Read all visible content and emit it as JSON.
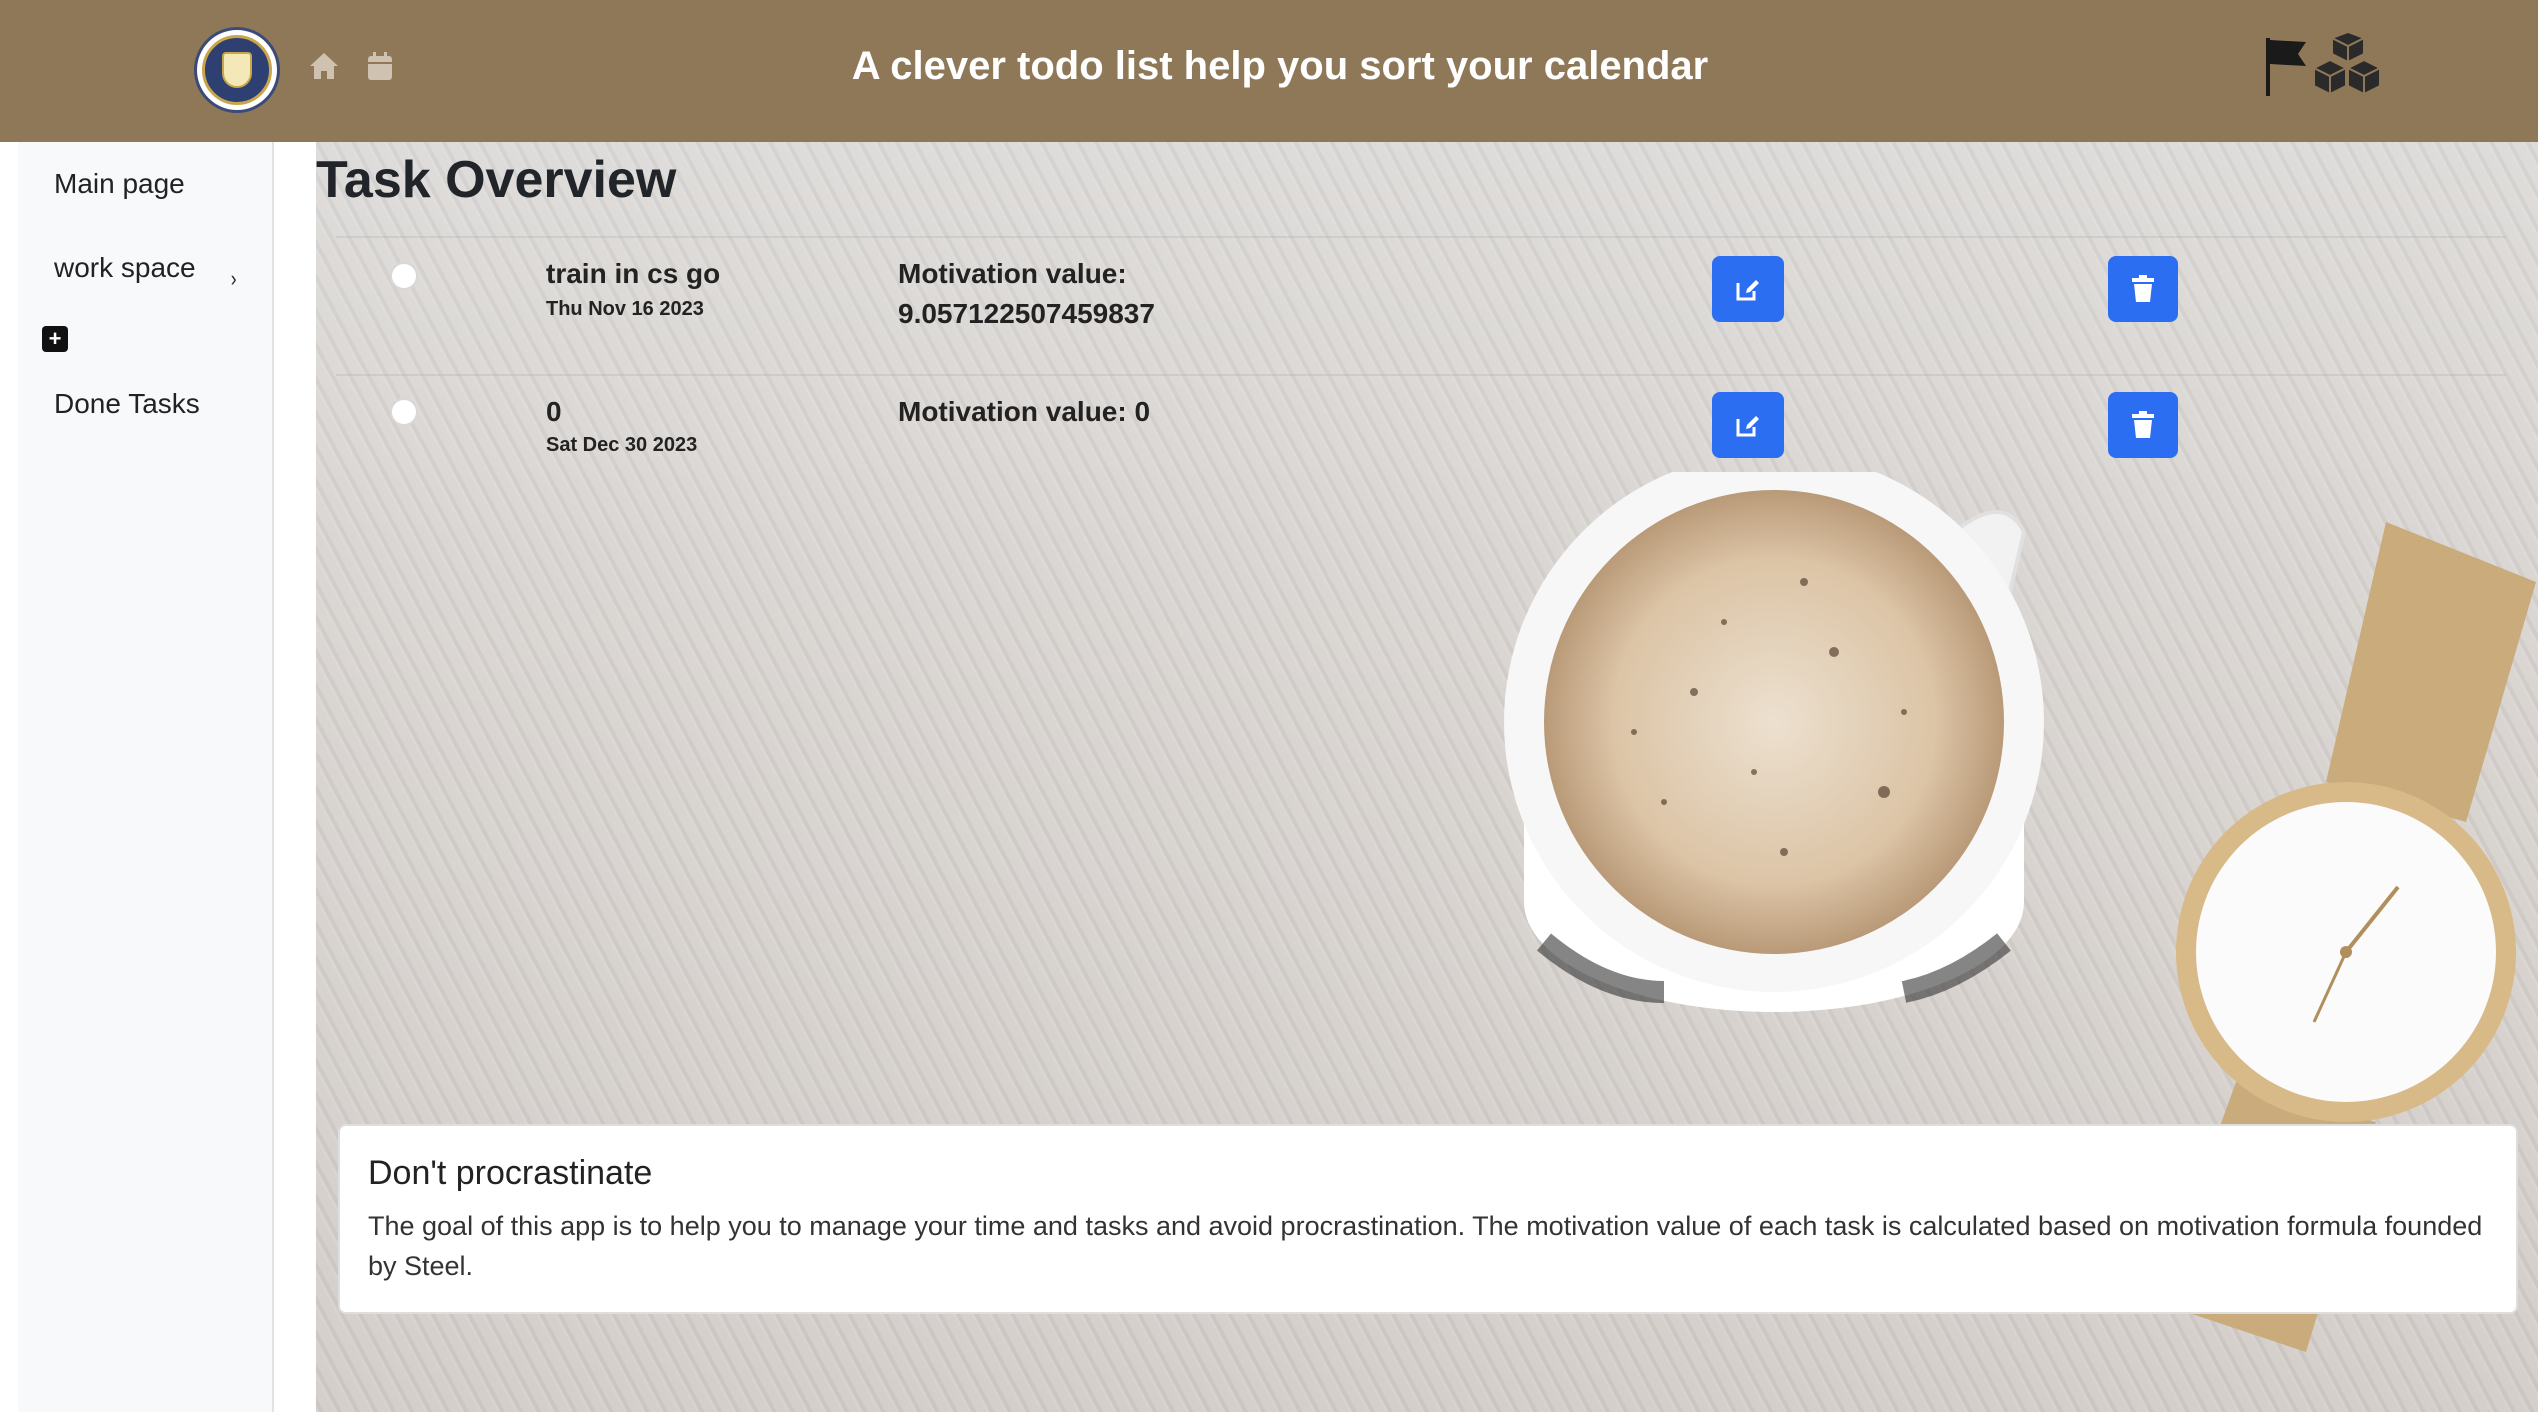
{
  "header": {
    "title": "A clever todo list help you sort your calendar",
    "logo": "university-seal-logo",
    "icons": [
      "home-icon",
      "calendar-icon"
    ],
    "right_logo": "flag-cubes-logo",
    "background_color": "#8f7857"
  },
  "sidebar": {
    "items": [
      {
        "label": "Main page"
      },
      {
        "label": "work space"
      },
      {
        "label": "Done Tasks"
      }
    ],
    "chevron": "›",
    "add_icon": "+"
  },
  "main": {
    "title": "Task Overview",
    "tasks": [
      {
        "name": "train in cs go",
        "date": "Thu Nov 16 2023",
        "motivation_label": "Motivation value:",
        "motivation_value": "9.057122507459837"
      },
      {
        "name": "0",
        "date": "Sat Dec 30 2023",
        "motivation_label": "Motivation value:",
        "motivation_value": "0"
      }
    ],
    "accent_color": "#2c6ef2"
  },
  "card": {
    "title": "Don't procrastinate",
    "text": "The goal of this app is to help you to manage your time and tasks and avoid procrastination. The motivation value of each task is calculated based on motivation formula founded by Steel."
  }
}
